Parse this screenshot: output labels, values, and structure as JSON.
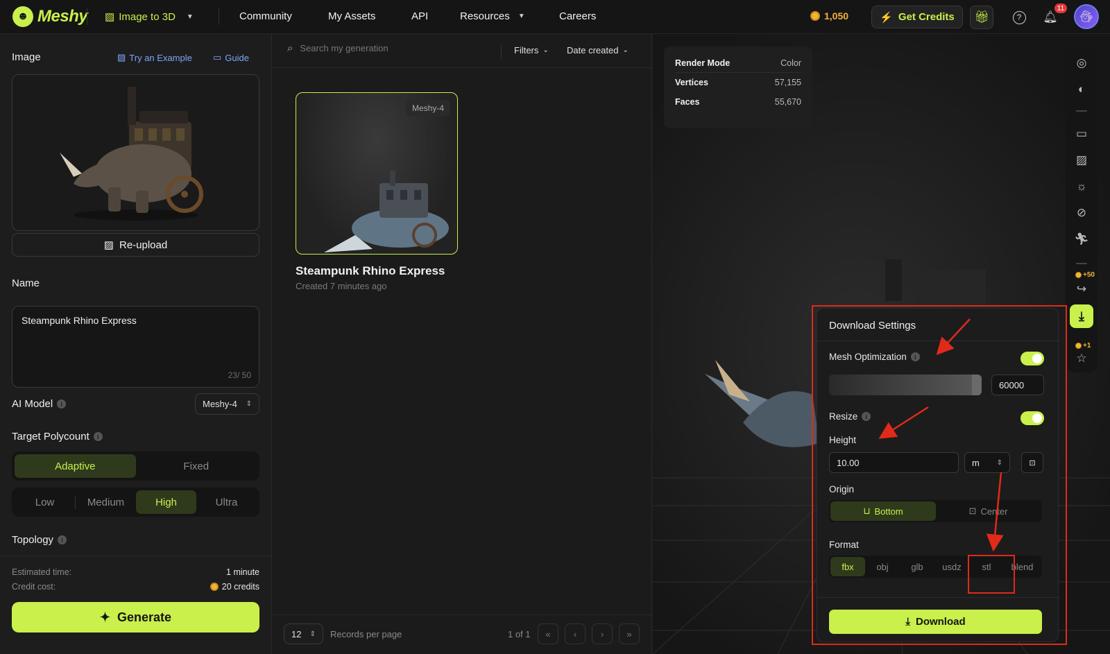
{
  "topbar": {
    "logo_text": "Meshy",
    "mode_label": "Image to 3D",
    "nav": [
      "Community",
      "My Assets",
      "API",
      "Resources",
      "Careers"
    ],
    "credits": "1,050",
    "get_credits_label": "Get Credits",
    "notification_count": "11"
  },
  "left": {
    "image_label": "Image",
    "try_example_label": "Try an Example",
    "guide_label": "Guide",
    "reupload_label": "Re-upload",
    "name_label": "Name",
    "name_value": "Steampunk Rhino Express",
    "name_counter": "23/ 50",
    "ai_model_label": "AI Model",
    "ai_model_value": "Meshy-4",
    "polycount_label": "Target Polycount",
    "polycount_modes": [
      "Adaptive",
      "Fixed"
    ],
    "polycount_mode_selected": "Adaptive",
    "quality_levels": [
      "Low",
      "Medium",
      "High",
      "Ultra"
    ],
    "quality_selected": "High",
    "topology_label": "Topology",
    "estimated_time_label": "Estimated time:",
    "estimated_time_value": "1 minute",
    "credit_cost_label": "Credit cost:",
    "credit_cost_value": "20 credits",
    "generate_label": "Generate"
  },
  "middle": {
    "search_placeholder": "Search my generation",
    "filters_label": "Filters",
    "sort_label": "Date created",
    "card": {
      "tag": "Meshy-4",
      "title": "Steampunk Rhino Express",
      "subtitle": "Created 7 minutes ago"
    },
    "per_page_value": "12",
    "per_page_label": "Records per page",
    "page_info": "1 of 1"
  },
  "viewport": {
    "stats": [
      {
        "k": "Render Mode",
        "v": "Color"
      },
      {
        "k": "Vertices",
        "v": "57,155"
      },
      {
        "k": "Faces",
        "v": "55,670"
      }
    ],
    "share_bonus": "+50",
    "rate_bonus": "+1"
  },
  "download_panel": {
    "title": "Download Settings",
    "mesh_optimization_label": "Mesh Optimization",
    "mesh_optimization_on": true,
    "polycount_value": "60000",
    "resize_label": "Resize",
    "resize_on": true,
    "height_label": "Height",
    "height_value": "10.00",
    "unit_value": "m",
    "origin_label": "Origin",
    "origin_options": [
      "Bottom",
      "Center"
    ],
    "origin_selected": "Bottom",
    "format_label": "Format",
    "formats": [
      "fbx",
      "obj",
      "glb",
      "usdz",
      "stl",
      "blend"
    ],
    "format_selected": "fbx",
    "download_label": "Download"
  },
  "colors": {
    "accent": "#c9f04b",
    "annotation": "#e02a1a",
    "coin": "#f0b43a"
  }
}
